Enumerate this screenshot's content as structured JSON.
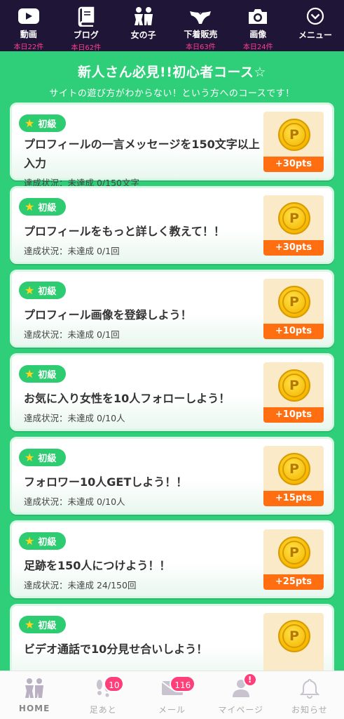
{
  "topnav": {
    "items": [
      {
        "label": "動画",
        "sub": "本日22件",
        "icon": "video-icon"
      },
      {
        "label": "ブログ",
        "sub": "本日62件",
        "icon": "book-icon"
      },
      {
        "label": "女の子",
        "sub": "",
        "icon": "girl-icon"
      },
      {
        "label": "下着販売",
        "sub": "本日63件",
        "icon": "underwear-icon"
      },
      {
        "label": "画像",
        "sub": "本日24件",
        "icon": "camera-icon"
      },
      {
        "label": "メニュー",
        "sub": "",
        "icon": "chevron-down-circle-icon"
      }
    ]
  },
  "header": {
    "title": "新人さん必見!!初心者コース☆",
    "subtitle": "サイトの遊び方がわからない！という方へのコースです！"
  },
  "tasks": [
    {
      "level": "初級",
      "title": "プロフィールの一言メッセージを150文字以上入力",
      "status": "達成状況：未達成 0/150文字",
      "points": "+30pts"
    },
    {
      "level": "初級",
      "title": "プロフィールをもっと詳しく教えて！！",
      "status": "達成状況：未達成 0/1回",
      "points": "+30pts"
    },
    {
      "level": "初級",
      "title": "プロフィール画像を登録しよう！",
      "status": "達成状況：未達成 0/1回",
      "points": "+10pts"
    },
    {
      "level": "初級",
      "title": "お気に入り女性を10人フォローしよう！",
      "status": "達成状況：未達成 0/10人",
      "points": "+10pts"
    },
    {
      "level": "初級",
      "title": "フォロワー10人GETしよう！！",
      "status": "達成状況：未達成 0/10人",
      "points": "+15pts"
    },
    {
      "level": "初級",
      "title": "足跡を150人につけよう！！",
      "status": "達成状況：未達成 24/150回",
      "points": "+25pts"
    },
    {
      "level": "初級",
      "title": "ビデオ通話で10分見せ合いしよう！",
      "status": "",
      "points": ""
    }
  ],
  "bottomnav": {
    "items": [
      {
        "label": "HOME",
        "badge": "",
        "icon": "home-icon"
      },
      {
        "label": "足あと",
        "badge": "10",
        "icon": "footprint-icon"
      },
      {
        "label": "メール",
        "badge": "116",
        "icon": "mail-icon"
      },
      {
        "label": "マイページ",
        "badge": "!",
        "icon": "user-icon"
      },
      {
        "label": "お知らせ",
        "badge": "",
        "icon": "bell-icon"
      }
    ]
  },
  "colors": {
    "nav_bg": "#1f1637",
    "accent_pink": "#ff3f8c",
    "green": "#2fcf7a",
    "orange": "#ff6f11"
  }
}
